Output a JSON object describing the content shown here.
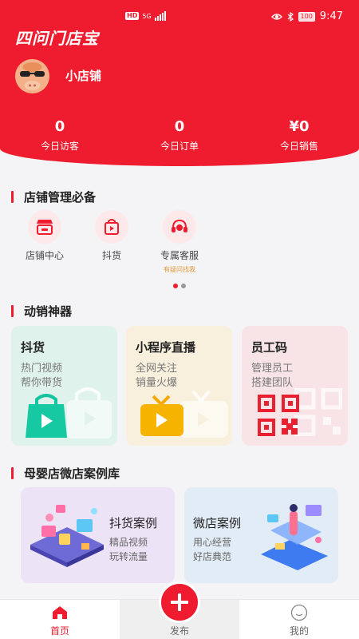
{
  "status_bar": {
    "network_badge": "HD",
    "network_type": "5G",
    "battery": "100",
    "time": "9:47"
  },
  "app": {
    "title": "四问门店宝"
  },
  "store": {
    "name": "小店铺",
    "avatar_icon": "mascot-avatar-icon"
  },
  "stats": [
    {
      "value": "0",
      "label": "今日访客"
    },
    {
      "value": "0",
      "label": "今日订单"
    },
    {
      "value": "¥0",
      "label": "今日销售"
    }
  ],
  "store_management": {
    "title": "店铺管理必备",
    "tools": [
      {
        "label": "店铺中心",
        "icon": "store-icon",
        "sub": ""
      },
      {
        "label": "抖货",
        "icon": "video-bag-icon",
        "sub": ""
      },
      {
        "label": "专属客服",
        "icon": "headset-icon",
        "sub": "有疑问找我"
      }
    ]
  },
  "sales_tools": {
    "title": "动销神器",
    "cards": [
      {
        "title": "抖货",
        "line1": "热门视频",
        "line2": "帮你带货",
        "icon": "shopping-bag-play-icon",
        "bg": "#dff2ec"
      },
      {
        "title": "小程序直播",
        "line1": "全网关注",
        "line2": "销量火爆",
        "icon": "tv-play-icon",
        "bg": "#f8f0dd"
      },
      {
        "title": "员工码",
        "line1": "管理员工",
        "line2": "搭建团队",
        "icon": "qr-code-icon",
        "bg": "#f8e4e6"
      }
    ]
  },
  "case_library": {
    "title": "母婴店微店案例库",
    "cases": [
      {
        "title": "抖货案例",
        "line1": "精品视频",
        "line2": "玩转流量",
        "bg": "#ece3f6"
      },
      {
        "title": "微店案例",
        "line1": "用心经营",
        "line2": "好店典范",
        "bg": "#e1ecf6"
      }
    ]
  },
  "tab_bar": {
    "tabs": [
      {
        "label": "首页",
        "icon": "home-icon"
      },
      {
        "label": "发布",
        "icon": "plus-icon"
      },
      {
        "label": "我的",
        "icon": "profile-face-icon"
      }
    ]
  },
  "colors": {
    "brand_red": "#ee1c2e",
    "accent_orange": "#e4993d"
  }
}
